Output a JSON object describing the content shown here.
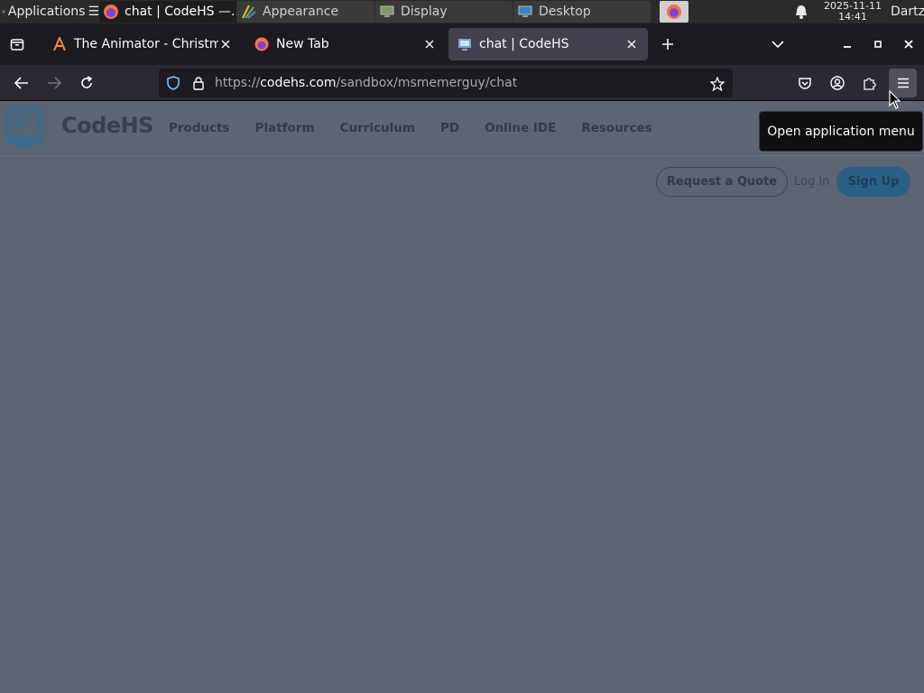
{
  "taskbar": {
    "apps_label": "Applications",
    "windows": [
      {
        "label": "chat | CodeHS —...",
        "active": true
      },
      {
        "label": "Appearance",
        "active": false
      },
      {
        "label": "Display",
        "active": false
      },
      {
        "label": "Desktop",
        "active": false
      }
    ],
    "clock_date": "2025-11-11",
    "clock_time": "14:41",
    "user": "Dartz"
  },
  "browser": {
    "tabs": [
      {
        "title": "The Animator - Christmas",
        "selected": false
      },
      {
        "title": "New Tab",
        "selected": false
      },
      {
        "title": "chat | CodeHS",
        "selected": true
      }
    ],
    "url_prefix": "https://",
    "url_domain": "codehs.com",
    "url_path": "/sandbox/msmemerguy/chat",
    "tooltip": "Open application menu"
  },
  "site": {
    "brand": "CodeHS",
    "nav": [
      "Products",
      "Platform",
      "Curriculum",
      "PD",
      "Online IDE",
      "Resources"
    ],
    "request_quote": "Request a Quote",
    "login": "Log In",
    "signup": "Sign Up"
  }
}
